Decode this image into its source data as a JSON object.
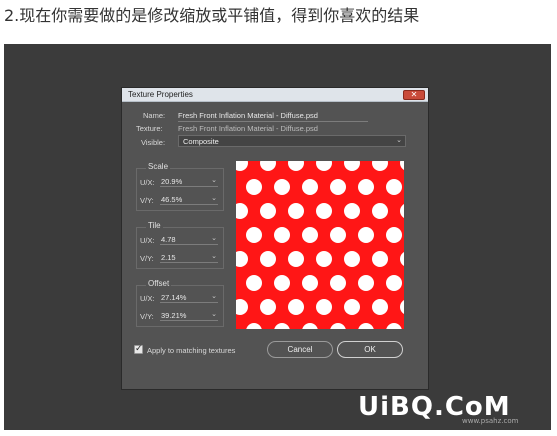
{
  "caption": "2.现在你需要做的是修改缩放或平铺值，得到你喜欢的结果",
  "dialog": {
    "title": "Texture Properties",
    "close_icon": "close-icon",
    "name_label": "Name:",
    "name_value": "Fresh Front Inflation Material - Diffuse.psd",
    "texture_label": "Texture:",
    "texture_value": "Fresh Front Inflation Material - Diffuse.psd",
    "visible_label": "Visible:",
    "visible_value": "Composite",
    "scale": {
      "title": "Scale",
      "ux_label": "U/X:",
      "ux_value": "20.9%",
      "vy_label": "V/Y:",
      "vy_value": "46.5%"
    },
    "tile": {
      "title": "Tile",
      "ux_label": "U/X:",
      "ux_value": "4.78",
      "vy_label": "V/Y:",
      "vy_value": "2.15"
    },
    "offset": {
      "title": "Offset",
      "ux_label": "U/X:",
      "ux_value": "27.14%",
      "vy_label": "V/Y:",
      "vy_value": "39.21%"
    },
    "preview": {
      "background": "#ff1616",
      "dot_color": "#ffffff"
    },
    "apply_label": "Apply to matching textures",
    "apply_checked": true,
    "cancel_label": "Cancel",
    "ok_label": "OK"
  },
  "watermark": {
    "text": "UiBQ.CoM",
    "sub": "www.psahz.com"
  }
}
